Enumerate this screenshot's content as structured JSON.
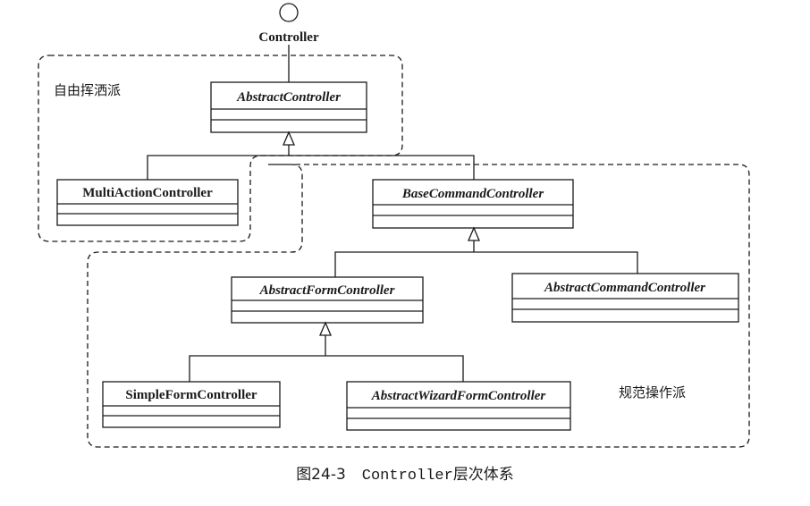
{
  "interface": {
    "label": "Controller"
  },
  "zones": {
    "free": {
      "label": "自由挥洒派"
    },
    "standard": {
      "label": "规范操作派"
    }
  },
  "classes": {
    "abstract_controller": {
      "name": "AbstractController",
      "abstract": true
    },
    "multi_action_controller": {
      "name": "MultiActionController",
      "abstract": false
    },
    "base_command_controller": {
      "name": "BaseCommandController",
      "abstract": true
    },
    "abstract_form_controller": {
      "name": "AbstractFormController",
      "abstract": true
    },
    "abstract_command_controller": {
      "name": "AbstractCommandController",
      "abstract": true
    },
    "simple_form_controller": {
      "name": "SimpleFormController",
      "abstract": false
    },
    "abstract_wizard_form_controller": {
      "name": "AbstractWizardFormController",
      "abstract": true
    }
  },
  "caption": {
    "number": "图24-3",
    "code": "Controller",
    "rest": "层次体系"
  }
}
